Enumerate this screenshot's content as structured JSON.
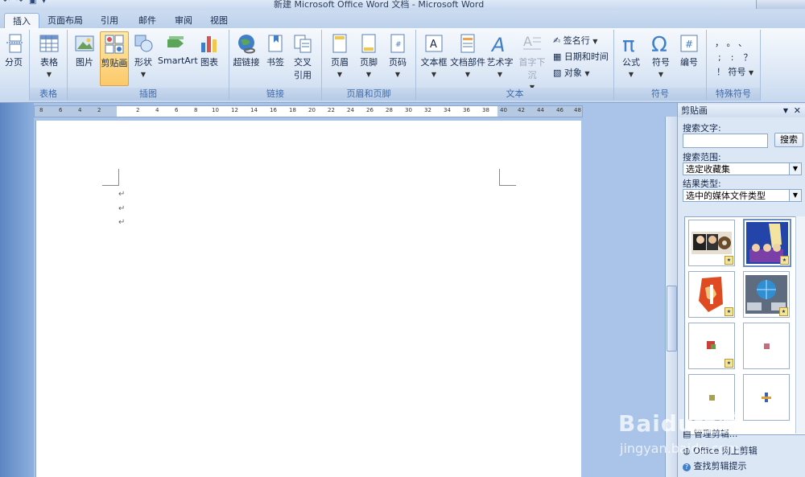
{
  "window": {
    "title": "新建 Microsoft Office Word 文档 - Microsoft Word"
  },
  "tabs": [
    {
      "label": "插入",
      "active": true
    },
    {
      "label": "页面布局"
    },
    {
      "label": "引用"
    },
    {
      "label": "邮件"
    },
    {
      "label": "审阅"
    },
    {
      "label": "视图"
    }
  ],
  "ribbon": {
    "pages_group": {
      "button": "分页"
    },
    "table_group": {
      "label": "表格",
      "button": "表格"
    },
    "illustrations": {
      "label": "插图",
      "buttons": [
        "图片",
        "剪贴画",
        "形状",
        "SmartArt",
        "图表"
      ]
    },
    "links": {
      "label": "链接",
      "buttons": [
        "超链接",
        "书签",
        "交叉",
        "引用"
      ]
    },
    "header_footer": {
      "label": "页眉和页脚",
      "buttons": [
        "页眉",
        "页脚",
        "页码"
      ]
    },
    "text": {
      "label": "文本",
      "buttons": [
        "文本框",
        "文档部件",
        "艺术字",
        "首字下沉"
      ],
      "small": [
        "签名行",
        "日期和时间",
        "对象"
      ]
    },
    "symbols": {
      "label": "符号",
      "buttons": [
        "公式",
        "符号",
        "编号"
      ]
    },
    "special": {
      "label": "特殊符号",
      "button": "符号",
      "chars": [
        "，",
        "。",
        "、",
        ";",
        ":",
        "？",
        "！"
      ]
    }
  },
  "ruler": {
    "numbers": [
      "8",
      "6",
      "4",
      "2",
      "2",
      "4",
      "6",
      "8",
      "10",
      "12",
      "14",
      "16",
      "18",
      "20",
      "22",
      "24",
      "26",
      "28",
      "30",
      "32",
      "34",
      "36",
      "38",
      "40",
      "42",
      "44",
      "46",
      "48"
    ]
  },
  "document": {
    "para_mark": "↵"
  },
  "clipart": {
    "title": "剪贴画",
    "search_label": "搜索文字:",
    "search_value": "",
    "search_button": "搜索",
    "scope_label": "搜索范围:",
    "scope_value": "选定收藏集",
    "type_label": "结果类型:",
    "type_value": "选中的媒体文件类型",
    "links": [
      "管理剪辑...",
      "Office 网上剪辑",
      "查找剪辑提示"
    ]
  },
  "watermark": {
    "logo": "Baidu经验",
    "url": "jingyan.baidu.com"
  },
  "colors": {
    "accent": "#f7c35f",
    "ribbon_label": "#3e6aaa"
  }
}
